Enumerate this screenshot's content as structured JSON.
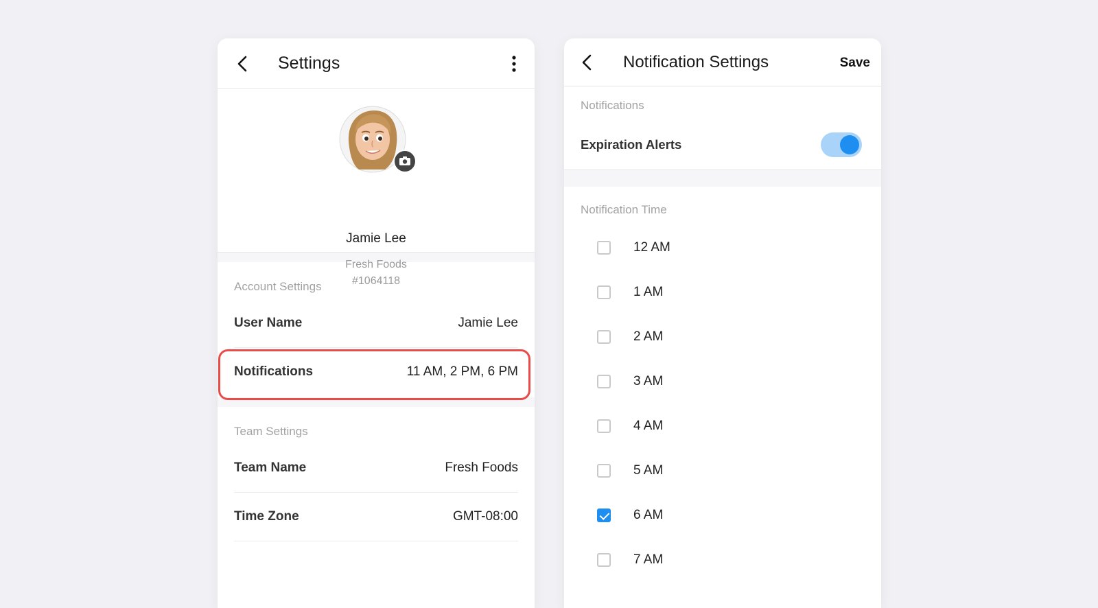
{
  "settings": {
    "title": "Settings",
    "profile": {
      "name": "Jamie Lee",
      "org": "Fresh Foods",
      "id": "#1064118"
    },
    "account_section": {
      "label": "Account Settings",
      "rows": [
        {
          "key": "User Name",
          "value": "Jamie Lee"
        },
        {
          "key": "Notifications",
          "value": "11 AM, 2 PM, 6 PM"
        }
      ]
    },
    "team_section": {
      "label": "Team Settings",
      "rows": [
        {
          "key": "Team Name",
          "value": "Fresh Foods"
        },
        {
          "key": "Time Zone",
          "value": "GMT-08:00"
        }
      ]
    }
  },
  "notification_settings": {
    "title": "Notification Settings",
    "save_label": "Save",
    "notifications_label": "Notifications",
    "expiration_alerts_label": "Expiration Alerts",
    "expiration_alerts_on": true,
    "time_label": "Notification Time",
    "times": [
      {
        "label": "12 AM",
        "checked": false
      },
      {
        "label": "1 AM",
        "checked": false
      },
      {
        "label": "2 AM",
        "checked": false
      },
      {
        "label": "3 AM",
        "checked": false
      },
      {
        "label": "4 AM",
        "checked": false
      },
      {
        "label": "5 AM",
        "checked": false
      },
      {
        "label": "6 AM",
        "checked": true
      },
      {
        "label": "7 AM",
        "checked": false
      }
    ]
  },
  "colors": {
    "accent": "#1e8ff0",
    "highlight": "#e94c48"
  }
}
